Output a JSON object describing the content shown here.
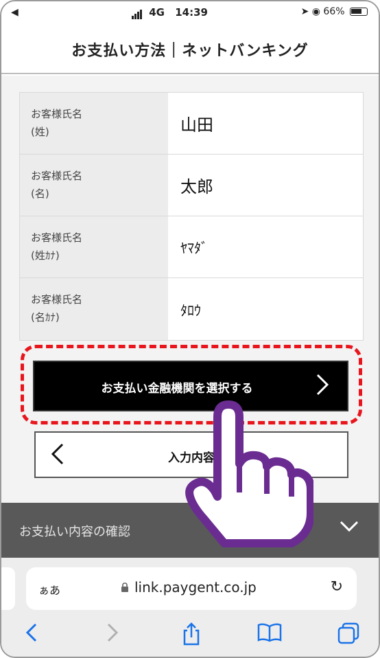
{
  "status_bar": {
    "back_glyph": "◀",
    "network": "4G",
    "time": "14:39",
    "battery": "66%"
  },
  "header": {
    "title": "お支払い方法｜ネットバンキング"
  },
  "form": {
    "rows": [
      {
        "label_main": "お客様氏名",
        "label_sub": "(姓)",
        "value": "山田"
      },
      {
        "label_main": "お客様氏名",
        "label_sub": "(名)",
        "value": "太郎"
      },
      {
        "label_main": "お客様氏名",
        "label_sub": "(姓ｶﾅ)",
        "value": "ﾔﾏﾀﾞ"
      },
      {
        "label_main": "お客様氏名",
        "label_sub": "(名ｶﾅ)",
        "value": "ﾀﾛｳ"
      }
    ]
  },
  "buttons": {
    "select_bank_label": "お支払い金融機関を選択する",
    "back_label": "入力内容"
  },
  "accordion": {
    "label": "お支払い内容の確認"
  },
  "browser": {
    "aa_label": "ぁあ",
    "url": "link.paygent.co.jp"
  },
  "colors": {
    "highlight": "#e8151c",
    "hand": "#6a2c91",
    "primary_button": "#000000",
    "accordion": "#595959",
    "ios_blue": "#1a73e8"
  }
}
